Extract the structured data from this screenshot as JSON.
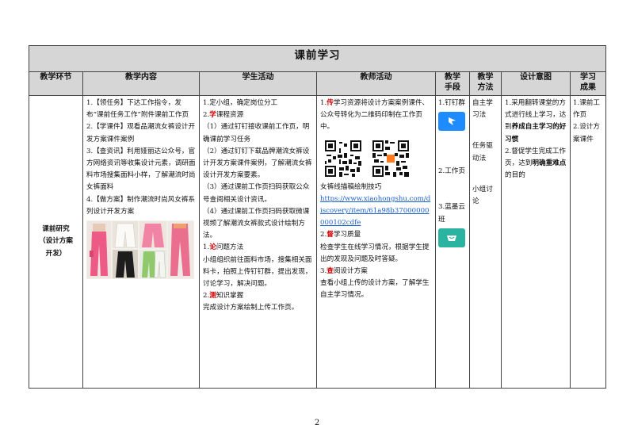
{
  "table": {
    "title": "课前学习",
    "headers": [
      "教学环节",
      "教学内容",
      "学生活动",
      "教师活动",
      "教学手段",
      "教学方法",
      "设计意图",
      "学习成果"
    ],
    "stage": "课前研究（设计方案开发）",
    "content": {
      "p1": "1.【领任务】下达工作指令，发布“课前任务工作”附件课前工作页",
      "p2": "2.【学课件】观看品潮流女裤设计开发方案课件案例",
      "p3": "3.【查资讯】利用娅丽达公众号，官方网络资讯等收集设计元素，调研面料市场搜集面料小样，了解潮流时尚女裤面料",
      "p4": "4.【做方案】制作潮流时尚风女裤系列设计开发方案"
    },
    "student": {
      "l1": "1.定小组，确定岗位分工",
      "l2_num": "2.",
      "l2_mark": "学",
      "l2_text": "课程资源",
      "l3": "（1）通过钉钉接收课前工作页，明确课前学习任务",
      "l4": "（2）通过钉钉下载品牌潮流女裤设计开发方案课件案例，了解潮流女裤设计开发方案要素。",
      "l5": "（3）通过课前工作页扫码获取公众号查阅相关设计资讯。",
      "l6": "（4）通过课前工作页扫码获取微课视频了解潮流女裤款式设计绘制方法。",
      "l7_num": "1.",
      "l7_mark": "论",
      "l7_text": "问题方法",
      "l8": "小组组织前往面料市场，搜集相关面料卡，拍照上传钉钉群，提出发现，讨论学习，解决问题。",
      "l9_num": "2.",
      "l9_mark": "测",
      "l9_text": "知识掌握",
      "l10": "完成设计方案绘制上传工作页。"
    },
    "teacher": {
      "l1_num": "1.",
      "l1_mark": "传",
      "l1_text": "学习资源将设计方案案例课件、公众号转化为二维码印制在工作页中。",
      "caption": "女裤线描稿绘制技巧",
      "link": "https://www.xiaohongshu.com/discovery/item/61a98b37000000000102cdfe",
      "l2_num": "2.",
      "l2_mark": "督",
      "l2_text": "学习质量",
      "l3": "检查学生在线学习情况，根据学生提出的发现及问题及时答疑。",
      "l4_num": "3.",
      "l4_mark": "查",
      "l4_text": "阅设计方案",
      "l5": "查看小组上传的设计方案，了解学生自主学习情况。"
    },
    "means": {
      "m1": "1.钉钉群",
      "m2": "2.工作页",
      "m3": "3.蓝墨云班"
    },
    "methods": {
      "m1": "自主学习法",
      "m2": "任务驱动法",
      "m3": "小组讨论"
    },
    "intent": {
      "a": "1.采用翻转课堂的方式进行线上学习，达到",
      "a_bold": "养成自主学习的好习惯",
      "b": "2.督促学生完成工作页，达到",
      "b_bold": "明确重难点",
      "b_end": "的目的"
    },
    "results": {
      "r1": "1.课前工作页",
      "r2": "2.设计方案课件"
    }
  },
  "page_number": "2",
  "colors": {
    "header_bg": "#d6d6d6",
    "mark_red": "#d40000",
    "link_blue": "#1a5fd0",
    "dingtalk_blue": "#1e8bff",
    "mosoteach_teal": "#2bb3a2"
  }
}
